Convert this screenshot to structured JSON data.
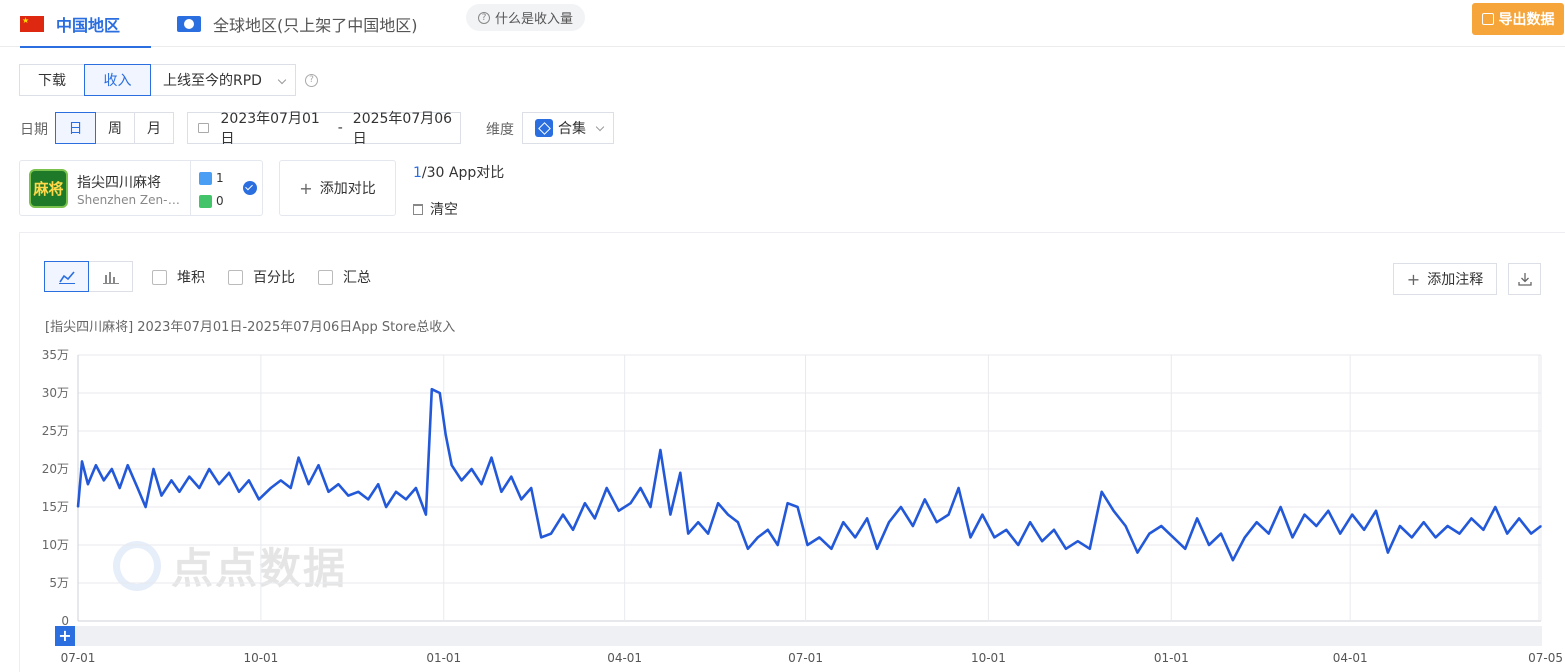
{
  "tabs": [
    {
      "label": "中国地区",
      "active": true
    },
    {
      "label": "全球地区(只上架了中国地区)",
      "active": false
    }
  ],
  "help_pill": "什么是收入量",
  "export_label": "导出数据",
  "metric_options": [
    "下载",
    "收入"
  ],
  "metric_selected": "收入",
  "rpd_select": "上线至今的RPD",
  "date_label": "日期",
  "granularity_options": [
    "日",
    "周",
    "月"
  ],
  "granularity_selected": "日",
  "date_range": {
    "start": "2023年07月01日",
    "sep": "-",
    "end": "2025年07月06日"
  },
  "dimension_label": "维度",
  "dimension_value": "合集",
  "app": {
    "icon_text": "麻将",
    "name": "指尖四川麻将",
    "developer": "Shenzhen Zen-Game Technology Co., Ltd.",
    "ios_count": "1",
    "android_count": "0"
  },
  "add_compare": "添加对比",
  "compare_count": {
    "current": "1",
    "rest": "/30 App对比"
  },
  "clear_label": "清空",
  "chart_options": [
    "堆积",
    "百分比",
    "汇总"
  ],
  "add_annotation": "添加注释",
  "chart_title": "[指尖四川麻将] 2023年07月01日-2025年07月06日App Store总收入",
  "watermark_text": "点点数据",
  "colors": {
    "accent": "#2a6ee0",
    "line": "#2359d9",
    "export": "#f5a53a"
  },
  "chart_data": {
    "type": "line",
    "title": "[指尖四川麻将] 2023年07月01日-2025年07月06日App Store总收入",
    "x_start": "2023-07-01",
    "x_end": "2025-07-06",
    "ylim": [
      0,
      350000
    ],
    "yticks": [
      {
        "v": 0,
        "label": "0"
      },
      {
        "v": 50000,
        "label": "5万"
      },
      {
        "v": 100000,
        "label": "10万"
      },
      {
        "v": 150000,
        "label": "15万"
      },
      {
        "v": 200000,
        "label": "20万"
      },
      {
        "v": 250000,
        "label": "25万"
      },
      {
        "v": 300000,
        "label": "30万"
      },
      {
        "v": 350000,
        "label": "35万"
      }
    ],
    "xticks": [
      {
        "date": "2023-07-01",
        "label": "07-01"
      },
      {
        "date": "2023-10-01",
        "label": "10-01"
      },
      {
        "date": "2024-01-01",
        "label": "01-01"
      },
      {
        "date": "2024-04-01",
        "label": "04-01"
      },
      {
        "date": "2024-07-01",
        "label": "07-01"
      },
      {
        "date": "2024-10-01",
        "label": "10-01"
      },
      {
        "date": "2025-01-01",
        "label": "01-01"
      },
      {
        "date": "2025-04-01",
        "label": "04-01"
      },
      {
        "date": "2025-07-05",
        "label": "07-05"
      }
    ],
    "grid": true,
    "series": [
      {
        "points": [
          [
            "2023-07-01",
            150000
          ],
          [
            "2023-07-03",
            210000
          ],
          [
            "2023-07-06",
            180000
          ],
          [
            "2023-07-10",
            205000
          ],
          [
            "2023-07-14",
            185000
          ],
          [
            "2023-07-18",
            200000
          ],
          [
            "2023-07-22",
            175000
          ],
          [
            "2023-07-26",
            205000
          ],
          [
            "2023-07-31",
            175000
          ],
          [
            "2023-08-04",
            150000
          ],
          [
            "2023-08-08",
            200000
          ],
          [
            "2023-08-12",
            165000
          ],
          [
            "2023-08-17",
            185000
          ],
          [
            "2023-08-21",
            170000
          ],
          [
            "2023-08-26",
            190000
          ],
          [
            "2023-08-31",
            175000
          ],
          [
            "2023-09-05",
            200000
          ],
          [
            "2023-09-10",
            180000
          ],
          [
            "2023-09-15",
            195000
          ],
          [
            "2023-09-20",
            170000
          ],
          [
            "2023-09-25",
            185000
          ],
          [
            "2023-09-30",
            160000
          ],
          [
            "2023-10-06",
            175000
          ],
          [
            "2023-10-11",
            185000
          ],
          [
            "2023-10-16",
            175000
          ],
          [
            "2023-10-20",
            215000
          ],
          [
            "2023-10-25",
            180000
          ],
          [
            "2023-10-30",
            205000
          ],
          [
            "2023-11-04",
            170000
          ],
          [
            "2023-11-09",
            180000
          ],
          [
            "2023-11-14",
            165000
          ],
          [
            "2023-11-19",
            170000
          ],
          [
            "2023-11-24",
            160000
          ],
          [
            "2023-11-29",
            180000
          ],
          [
            "2023-12-03",
            150000
          ],
          [
            "2023-12-08",
            170000
          ],
          [
            "2023-12-13",
            160000
          ],
          [
            "2023-12-18",
            175000
          ],
          [
            "2023-12-23",
            140000
          ],
          [
            "2023-12-26",
            305000
          ],
          [
            "2023-12-30",
            300000
          ],
          [
            "2024-01-02",
            245000
          ],
          [
            "2024-01-05",
            205000
          ],
          [
            "2024-01-10",
            185000
          ],
          [
            "2024-01-15",
            200000
          ],
          [
            "2024-01-20",
            180000
          ],
          [
            "2024-01-25",
            215000
          ],
          [
            "2024-01-30",
            170000
          ],
          [
            "2024-02-04",
            190000
          ],
          [
            "2024-02-09",
            160000
          ],
          [
            "2024-02-14",
            175000
          ],
          [
            "2024-02-19",
            110000
          ],
          [
            "2024-02-24",
            115000
          ],
          [
            "2024-03-01",
            140000
          ],
          [
            "2024-03-06",
            120000
          ],
          [
            "2024-03-12",
            155000
          ],
          [
            "2024-03-17",
            135000
          ],
          [
            "2024-03-23",
            175000
          ],
          [
            "2024-03-29",
            145000
          ],
          [
            "2024-04-04",
            155000
          ],
          [
            "2024-04-09",
            175000
          ],
          [
            "2024-04-14",
            150000
          ],
          [
            "2024-04-19",
            225000
          ],
          [
            "2024-04-24",
            140000
          ],
          [
            "2024-04-29",
            195000
          ],
          [
            "2024-05-03",
            115000
          ],
          [
            "2024-05-08",
            130000
          ],
          [
            "2024-05-13",
            115000
          ],
          [
            "2024-05-18",
            155000
          ],
          [
            "2024-05-23",
            140000
          ],
          [
            "2024-05-28",
            130000
          ],
          [
            "2024-06-02",
            95000
          ],
          [
            "2024-06-07",
            110000
          ],
          [
            "2024-06-12",
            120000
          ],
          [
            "2024-06-17",
            100000
          ],
          [
            "2024-06-22",
            155000
          ],
          [
            "2024-06-27",
            150000
          ],
          [
            "2024-07-02",
            100000
          ],
          [
            "2024-07-08",
            110000
          ],
          [
            "2024-07-14",
            95000
          ],
          [
            "2024-07-20",
            130000
          ],
          [
            "2024-07-26",
            110000
          ],
          [
            "2024-08-01",
            135000
          ],
          [
            "2024-08-06",
            95000
          ],
          [
            "2024-08-12",
            130000
          ],
          [
            "2024-08-18",
            150000
          ],
          [
            "2024-08-24",
            125000
          ],
          [
            "2024-08-30",
            160000
          ],
          [
            "2024-09-05",
            130000
          ],
          [
            "2024-09-11",
            140000
          ],
          [
            "2024-09-16",
            175000
          ],
          [
            "2024-09-22",
            110000
          ],
          [
            "2024-09-28",
            140000
          ],
          [
            "2024-10-04",
            110000
          ],
          [
            "2024-10-10",
            120000
          ],
          [
            "2024-10-16",
            100000
          ],
          [
            "2024-10-22",
            130000
          ],
          [
            "2024-10-28",
            105000
          ],
          [
            "2024-11-03",
            120000
          ],
          [
            "2024-11-09",
            95000
          ],
          [
            "2024-11-15",
            105000
          ],
          [
            "2024-11-21",
            95000
          ],
          [
            "2024-11-27",
            170000
          ],
          [
            "2024-12-03",
            145000
          ],
          [
            "2024-12-09",
            125000
          ],
          [
            "2024-12-15",
            90000
          ],
          [
            "2024-12-21",
            115000
          ],
          [
            "2024-12-27",
            125000
          ],
          [
            "2025-01-02",
            110000
          ],
          [
            "2025-01-08",
            95000
          ],
          [
            "2025-01-14",
            135000
          ],
          [
            "2025-01-20",
            100000
          ],
          [
            "2025-01-26",
            115000
          ],
          [
            "2025-02-01",
            80000
          ],
          [
            "2025-02-07",
            110000
          ],
          [
            "2025-02-13",
            130000
          ],
          [
            "2025-02-19",
            115000
          ],
          [
            "2025-02-25",
            150000
          ],
          [
            "2025-03-03",
            110000
          ],
          [
            "2025-03-09",
            140000
          ],
          [
            "2025-03-15",
            125000
          ],
          [
            "2025-03-21",
            145000
          ],
          [
            "2025-03-27",
            115000
          ],
          [
            "2025-04-02",
            140000
          ],
          [
            "2025-04-08",
            120000
          ],
          [
            "2025-04-14",
            145000
          ],
          [
            "2025-04-20",
            90000
          ],
          [
            "2025-04-26",
            125000
          ],
          [
            "2025-05-02",
            110000
          ],
          [
            "2025-05-08",
            130000
          ],
          [
            "2025-05-14",
            110000
          ],
          [
            "2025-05-20",
            125000
          ],
          [
            "2025-05-26",
            115000
          ],
          [
            "2025-06-01",
            135000
          ],
          [
            "2025-06-07",
            120000
          ],
          [
            "2025-06-13",
            150000
          ],
          [
            "2025-06-19",
            115000
          ],
          [
            "2025-06-25",
            135000
          ],
          [
            "2025-07-01",
            115000
          ],
          [
            "2025-07-06",
            125000
          ]
        ]
      }
    ]
  }
}
